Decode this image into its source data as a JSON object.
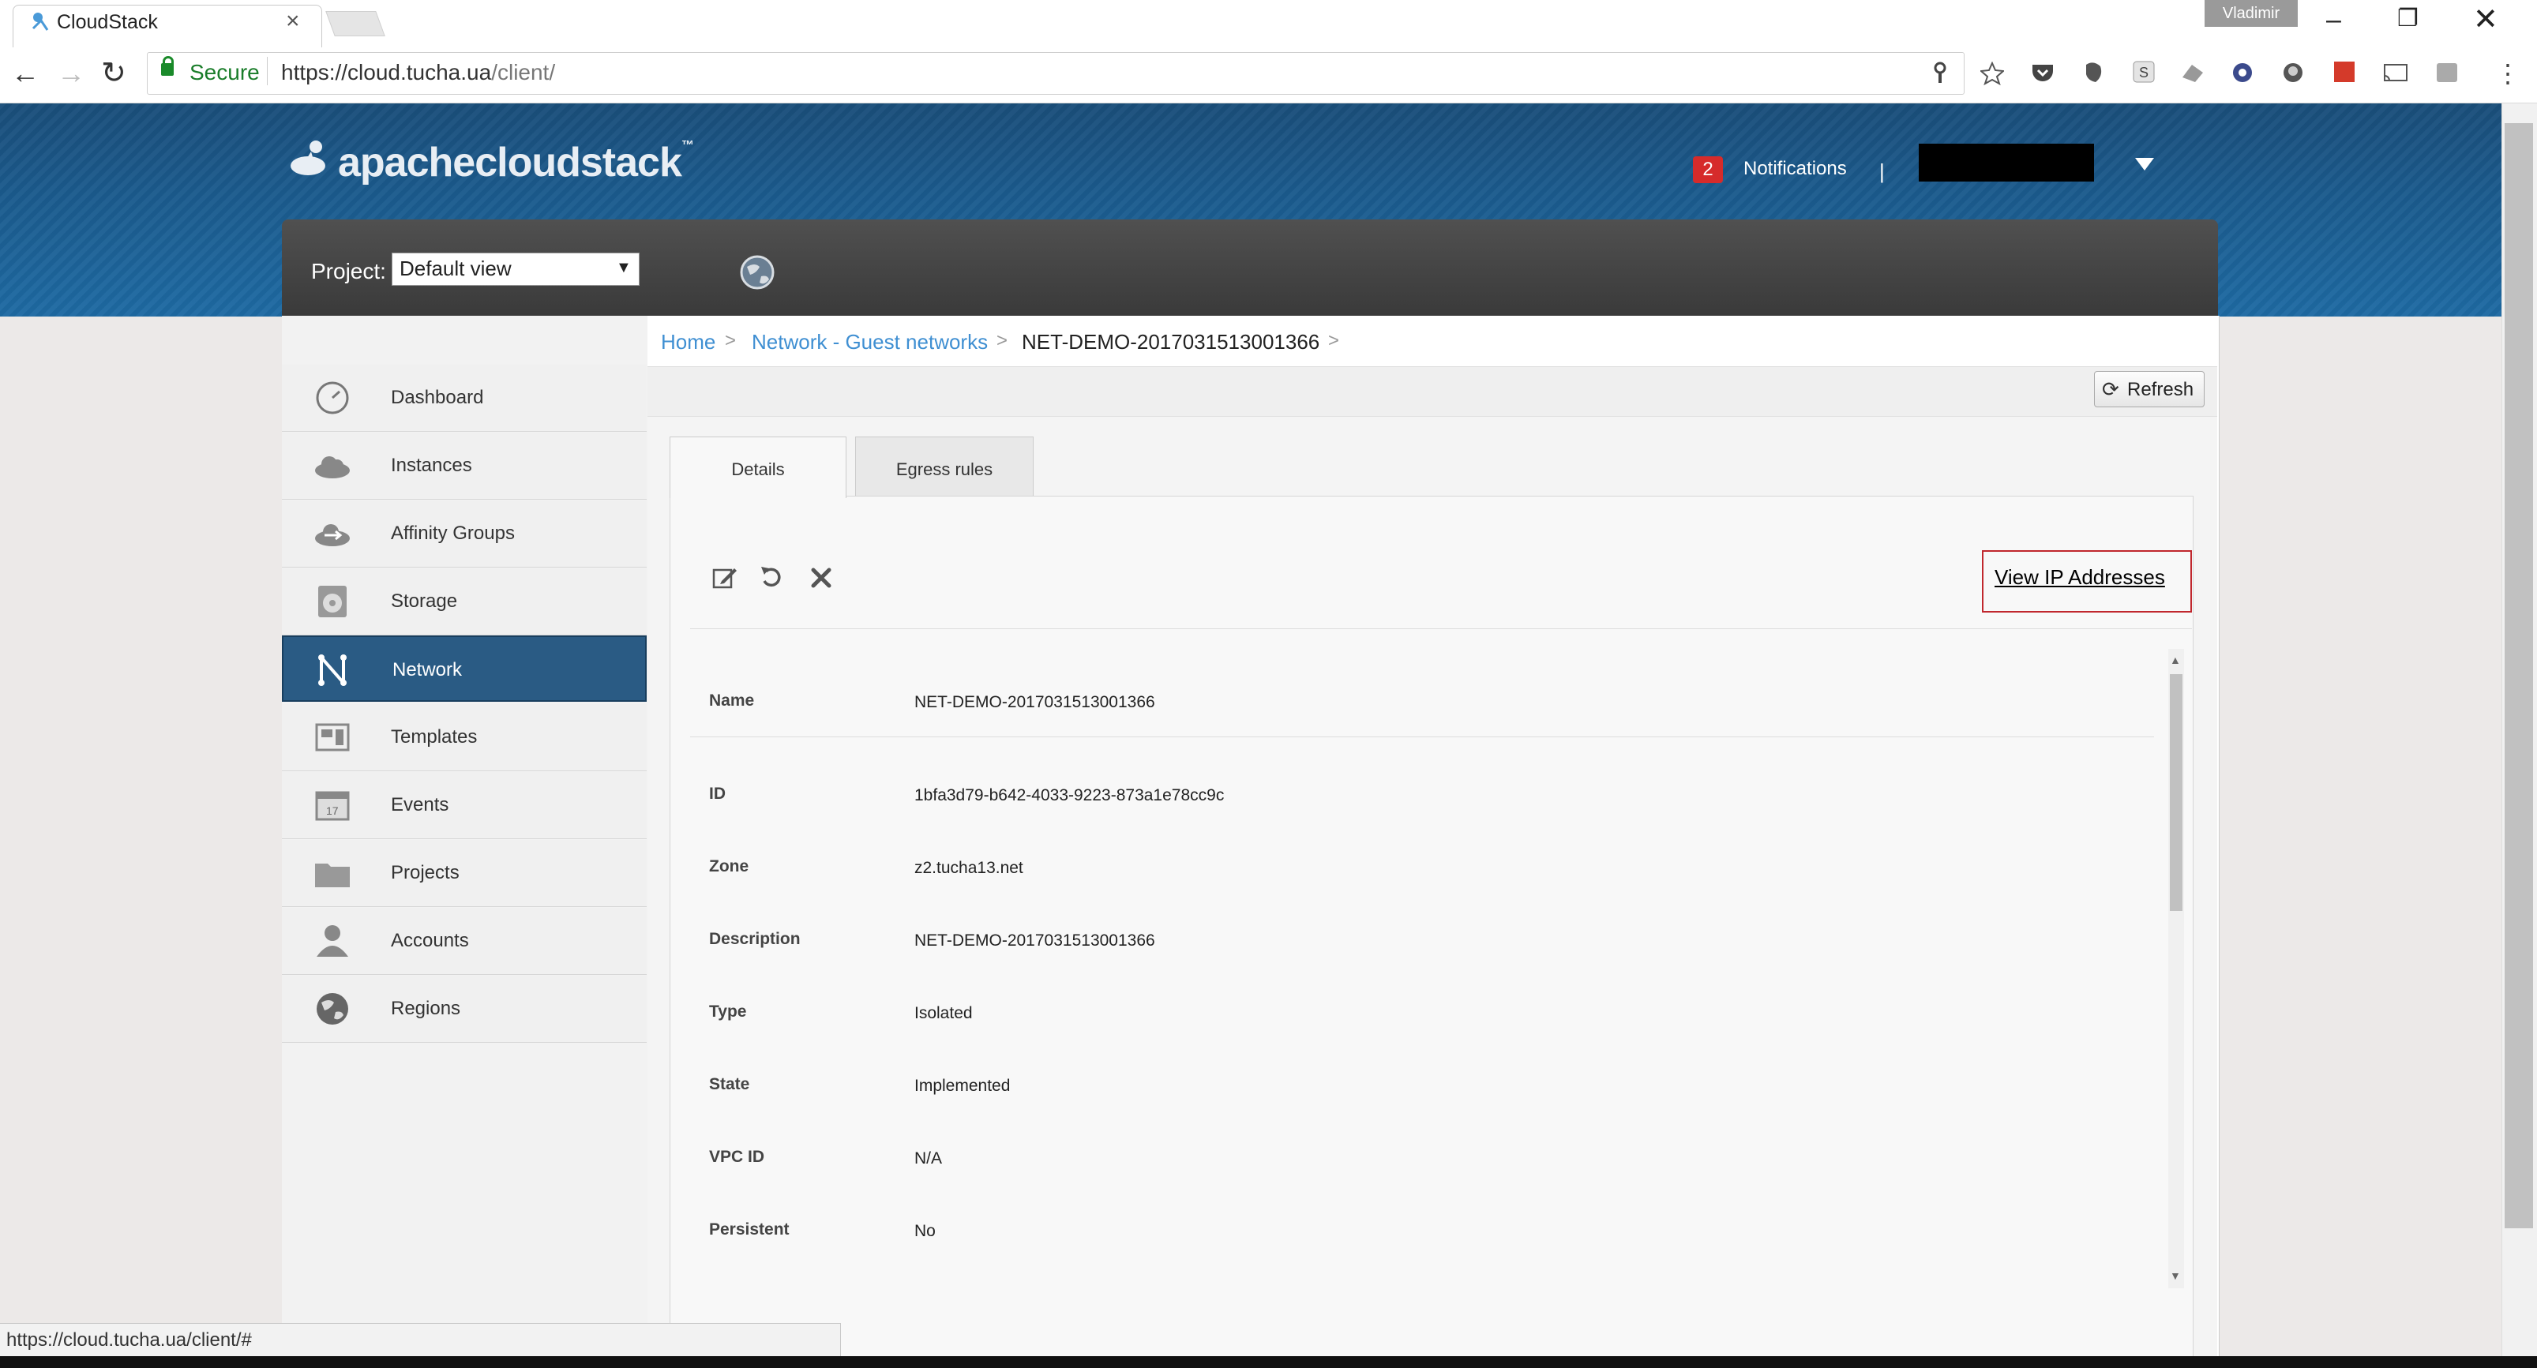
{
  "browser": {
    "tab_title": "CloudStack",
    "tab_close": "×",
    "window_user": "Vladimir",
    "window_min": "–",
    "window_max": "❐",
    "window_close": "✕",
    "nav_back": "←",
    "nav_forward": "→",
    "nav_reload": "↻",
    "secure_label": "Secure",
    "url_host": "https://cloud.tucha.ua",
    "url_path": "/client/",
    "menu_dots": "⋮",
    "status_url": "https://cloud.tucha.ua/client/#"
  },
  "header": {
    "logo_text": "apachecloudstack",
    "logo_tm": "™",
    "notifications_count": "2",
    "notifications_label": "Notifications",
    "separator": "|",
    "project_label": "Project:",
    "project_value": "Default view",
    "project_caret": "▼"
  },
  "sidebar": {
    "items": [
      {
        "label": "Dashboard",
        "icon": "dashboard-icon"
      },
      {
        "label": "Instances",
        "icon": "cloud-icon"
      },
      {
        "label": "Affinity Groups",
        "icon": "affinity-icon"
      },
      {
        "label": "Storage",
        "icon": "storage-icon"
      },
      {
        "label": "Network",
        "icon": "network-icon",
        "active": true
      },
      {
        "label": "Templates",
        "icon": "templates-icon"
      },
      {
        "label": "Events",
        "icon": "calendar-icon"
      },
      {
        "label": "Projects",
        "icon": "folder-icon"
      },
      {
        "label": "Accounts",
        "icon": "user-icon"
      },
      {
        "label": "Regions",
        "icon": "globe-icon"
      }
    ]
  },
  "breadcrumb": {
    "home": "Home",
    "network": "Network - Guest networks",
    "current": "NET-DEMO-2017031513001366",
    "sep": ">"
  },
  "toolbar": {
    "refresh_icon": "⟳",
    "refresh_label": "Refresh"
  },
  "tabs": {
    "details": "Details",
    "egress": "Egress rules"
  },
  "actions": {
    "edit_icon": "✎",
    "restart_icon": "↻",
    "delete_icon": "✖",
    "view_ip_addresses": "View IP Addresses"
  },
  "details": {
    "rows": [
      {
        "label": "Name",
        "value": "NET-DEMO-2017031513001366"
      },
      {
        "label": "ID",
        "value": "1bfa3d79-b642-4033-9223-873a1e78cc9c"
      },
      {
        "label": "Zone",
        "value": "z2.tucha13.net"
      },
      {
        "label": "Description",
        "value": "NET-DEMO-2017031513001366"
      },
      {
        "label": "Type",
        "value": "Isolated"
      },
      {
        "label": "State",
        "value": "Implemented"
      },
      {
        "label": "VPC ID",
        "value": "N/A"
      },
      {
        "label": "Persistent",
        "value": "No"
      }
    ],
    "scroll_up": "▲",
    "scroll_down": "▼"
  },
  "colors": {
    "header_blue": "#1b5a8c",
    "active_nav": "#2a5b84",
    "link_blue": "#3f8fd2",
    "highlight_red": "#c0272d",
    "badge_red": "#d62b2b"
  }
}
